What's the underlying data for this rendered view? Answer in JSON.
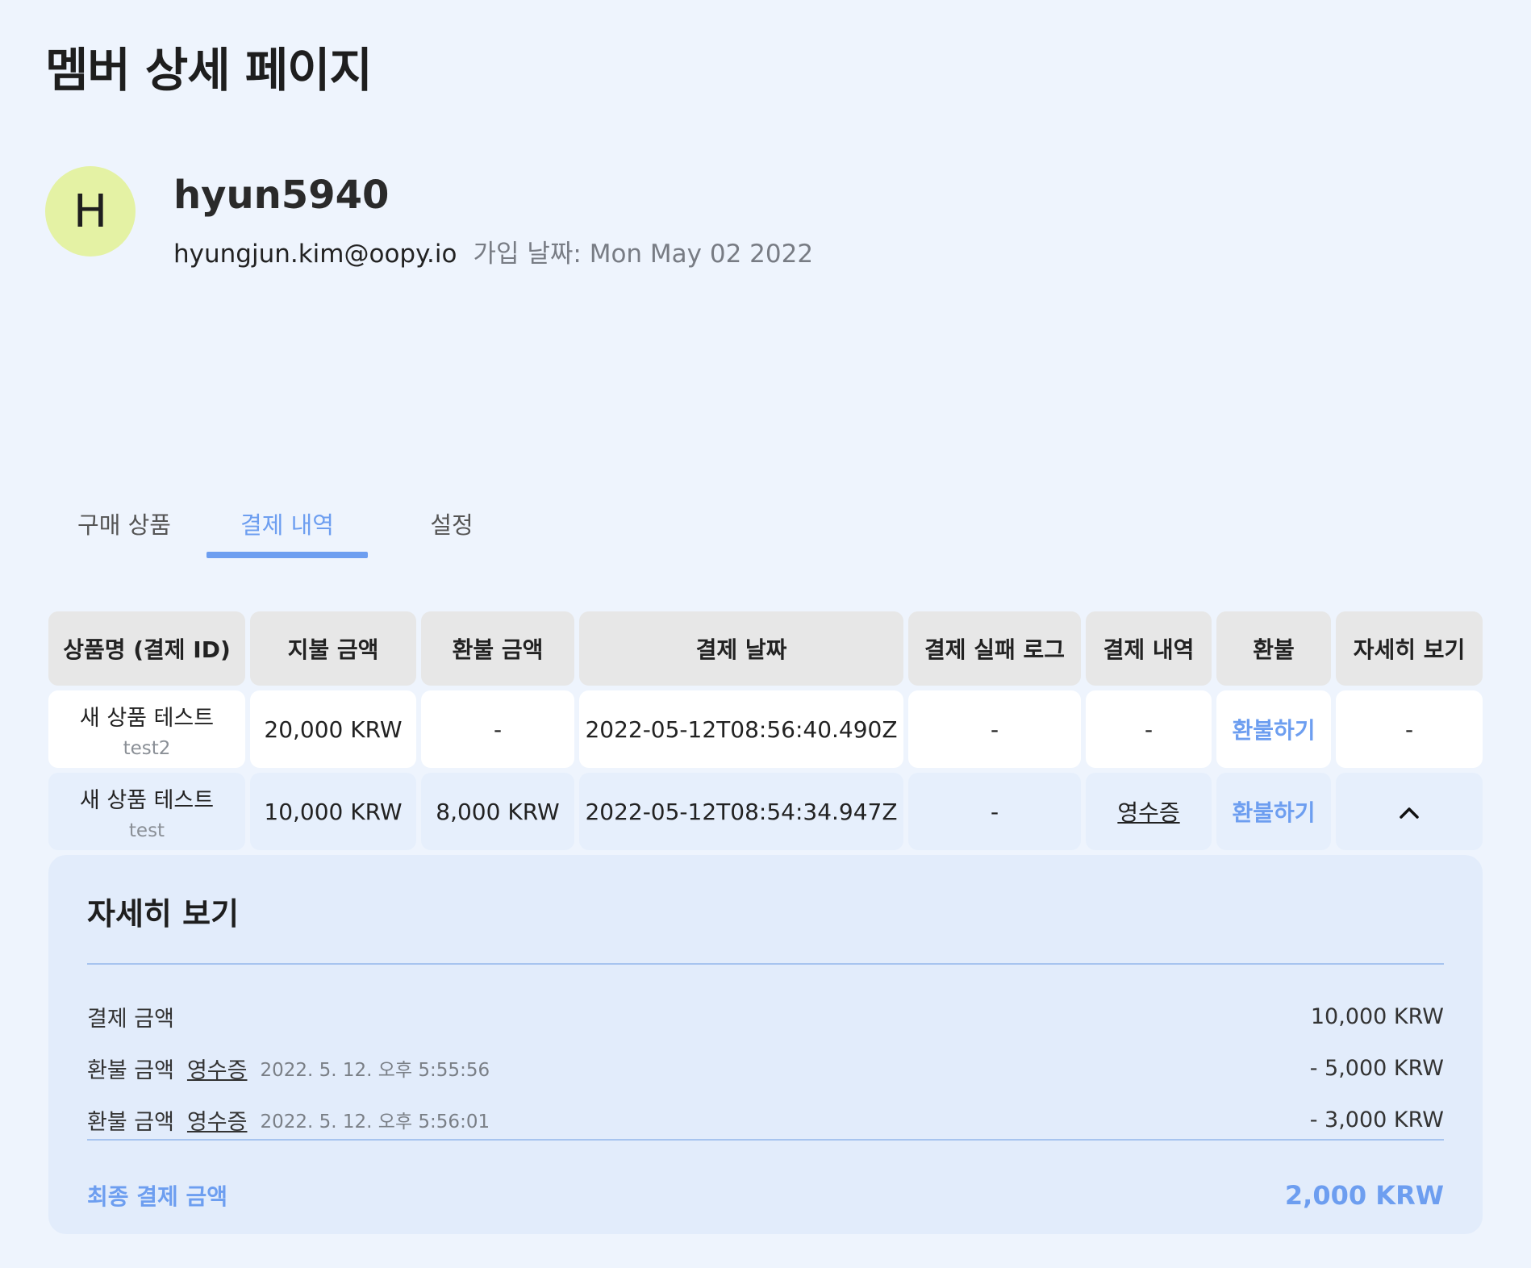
{
  "page_title": "멤버 상세 페이지",
  "profile": {
    "avatar_letter": "H",
    "username": "hyun5940",
    "email": "hyungjun.kim@oopy.io",
    "joined": "가입 날짜: Mon May 02 2022"
  },
  "tabs": [
    {
      "label": "구매 상품",
      "active": false
    },
    {
      "label": "결제 내역",
      "active": true
    },
    {
      "label": "설정",
      "active": false
    }
  ],
  "table": {
    "headers": [
      "상품명 (결제 ID)",
      "지불 금액",
      "환불 금액",
      "결제 날짜",
      "결제 실패 로그",
      "결제 내역",
      "환불",
      "자세히 보기"
    ],
    "rows": [
      {
        "product": "새 상품 테스트",
        "payment_id": "test2",
        "paid": "20,000 KRW",
        "refunded": "-",
        "date": "2022-05-12T08:56:40.490Z",
        "fail_log": "-",
        "receipt": "-",
        "refund": "환불하기",
        "details": "-"
      },
      {
        "product": "새 상품 테스트",
        "payment_id": "test",
        "paid": "10,000 KRW",
        "refunded": "8,000 KRW",
        "date": "2022-05-12T08:54:34.947Z",
        "fail_log": "-",
        "receipt": "영수증",
        "refund": "환불하기",
        "details_icon": "chevron-up-icon"
      }
    ]
  },
  "details": {
    "title": "자세히 보기",
    "payment_label": "결제 금액",
    "payment_amount": "10,000 KRW",
    "refunds": [
      {
        "label": "환불 금액",
        "receipt": "영수증",
        "time": "2022. 5. 12. 오후 5:55:56",
        "amount": "- 5,000 KRW"
      },
      {
        "label": "환불 금액",
        "receipt": "영수증",
        "time": "2022. 5. 12. 오후 5:56:01",
        "amount": "- 3,000 KRW"
      }
    ],
    "final_label": "최종 결제 금액",
    "final_amount": "2,000 KRW"
  },
  "colors": {
    "accent": "#6d9ef0",
    "avatar_bg": "#e4f2a4",
    "page_bg": "#eef4fd"
  }
}
